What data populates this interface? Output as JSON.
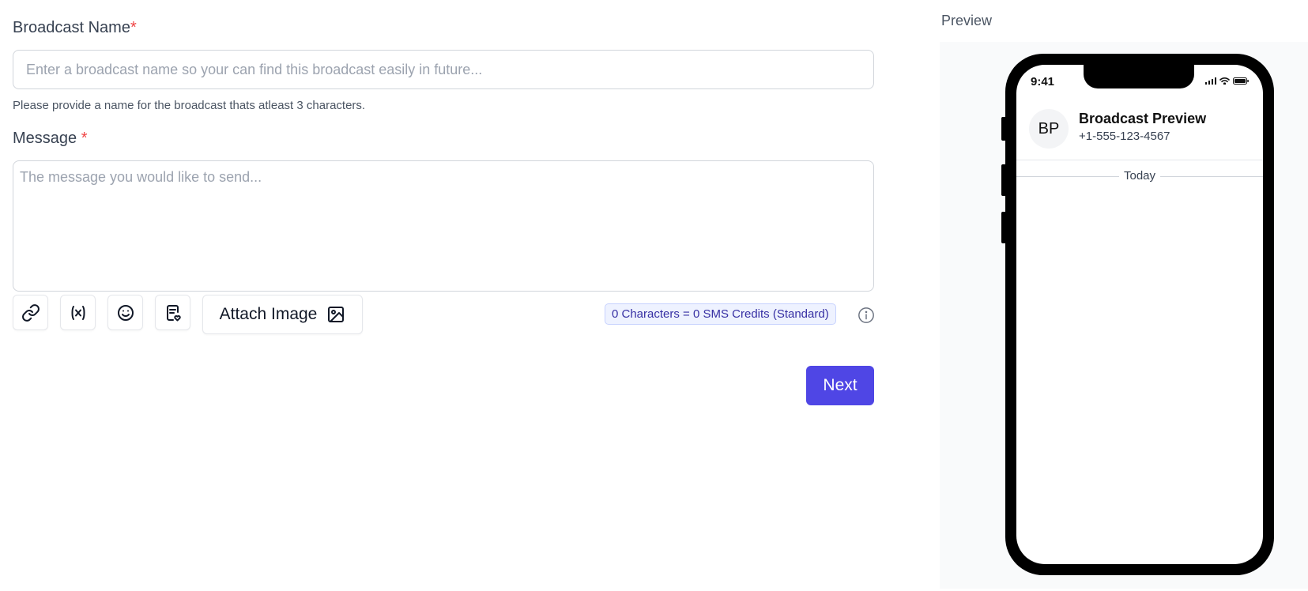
{
  "form": {
    "broadcast_name_label": "Broadcast Name",
    "required_mark": "*",
    "broadcast_name_placeholder": "Enter a broadcast name so your can find this broadcast easily in future...",
    "broadcast_name_value": "",
    "broadcast_name_helper": "Please provide a name for the broadcast thats atleast 3 characters.",
    "message_label": "Message",
    "message_placeholder": "The message you would like to send...",
    "message_value": ""
  },
  "toolbar": {
    "tools": [
      "link-icon",
      "variable-icon",
      "emoji-icon",
      "template-icon"
    ],
    "attach_label": "Attach Image",
    "credits_text": "0 Characters = 0 SMS Credits (Standard)"
  },
  "actions": {
    "next_label": "Next"
  },
  "preview": {
    "title": "Preview",
    "status_time": "9:41",
    "avatar_initials": "BP",
    "contact_name": "Broadcast Preview",
    "contact_phone": "+1-555-123-4567",
    "date_separator": "Today"
  },
  "colors": {
    "primary": "#4f46e5",
    "required": "#ef4444",
    "credits_bg": "#eef2ff",
    "credits_text": "#3730a3"
  }
}
